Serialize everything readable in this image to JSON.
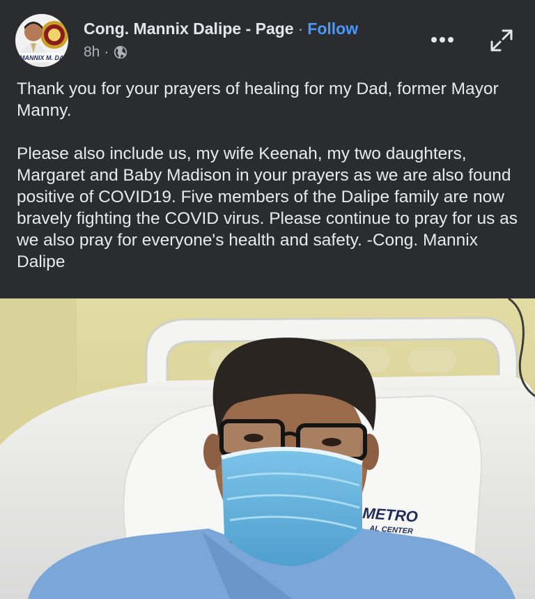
{
  "post": {
    "author_name": "Cong. Mannix Dalipe - Page",
    "separator": "·",
    "follow_label": "Follow",
    "time": "8h",
    "time_separator": "·",
    "privacy_icon": "globe-icon",
    "more_icon": "more-options-icon",
    "expand_icon": "expand-icon",
    "avatar_caption": "MANNIX M. DA",
    "paragraphs": [
      "Thank you for your prayers of healing for my Dad, former Mayor Manny.",
      "Please also include us, my wife Keenah, my two daughters, Margaret and Baby Madison in your prayers as we are also found positive of COVID19. Five members of the Dalipe family are now bravely fighting the COVID virus. Please continue to pray for us as we also pray for everyone's health and safety. -Cong. Mannix Dalipe"
    ]
  },
  "photo": {
    "pillow_logo_line1": "METRO",
    "pillow_logo_line2": "AL CENTER"
  },
  "colors": {
    "background": "#2b2c2f",
    "text": "#e4e6eb",
    "secondary_text": "#b0b3b8",
    "link": "#4599ff"
  }
}
